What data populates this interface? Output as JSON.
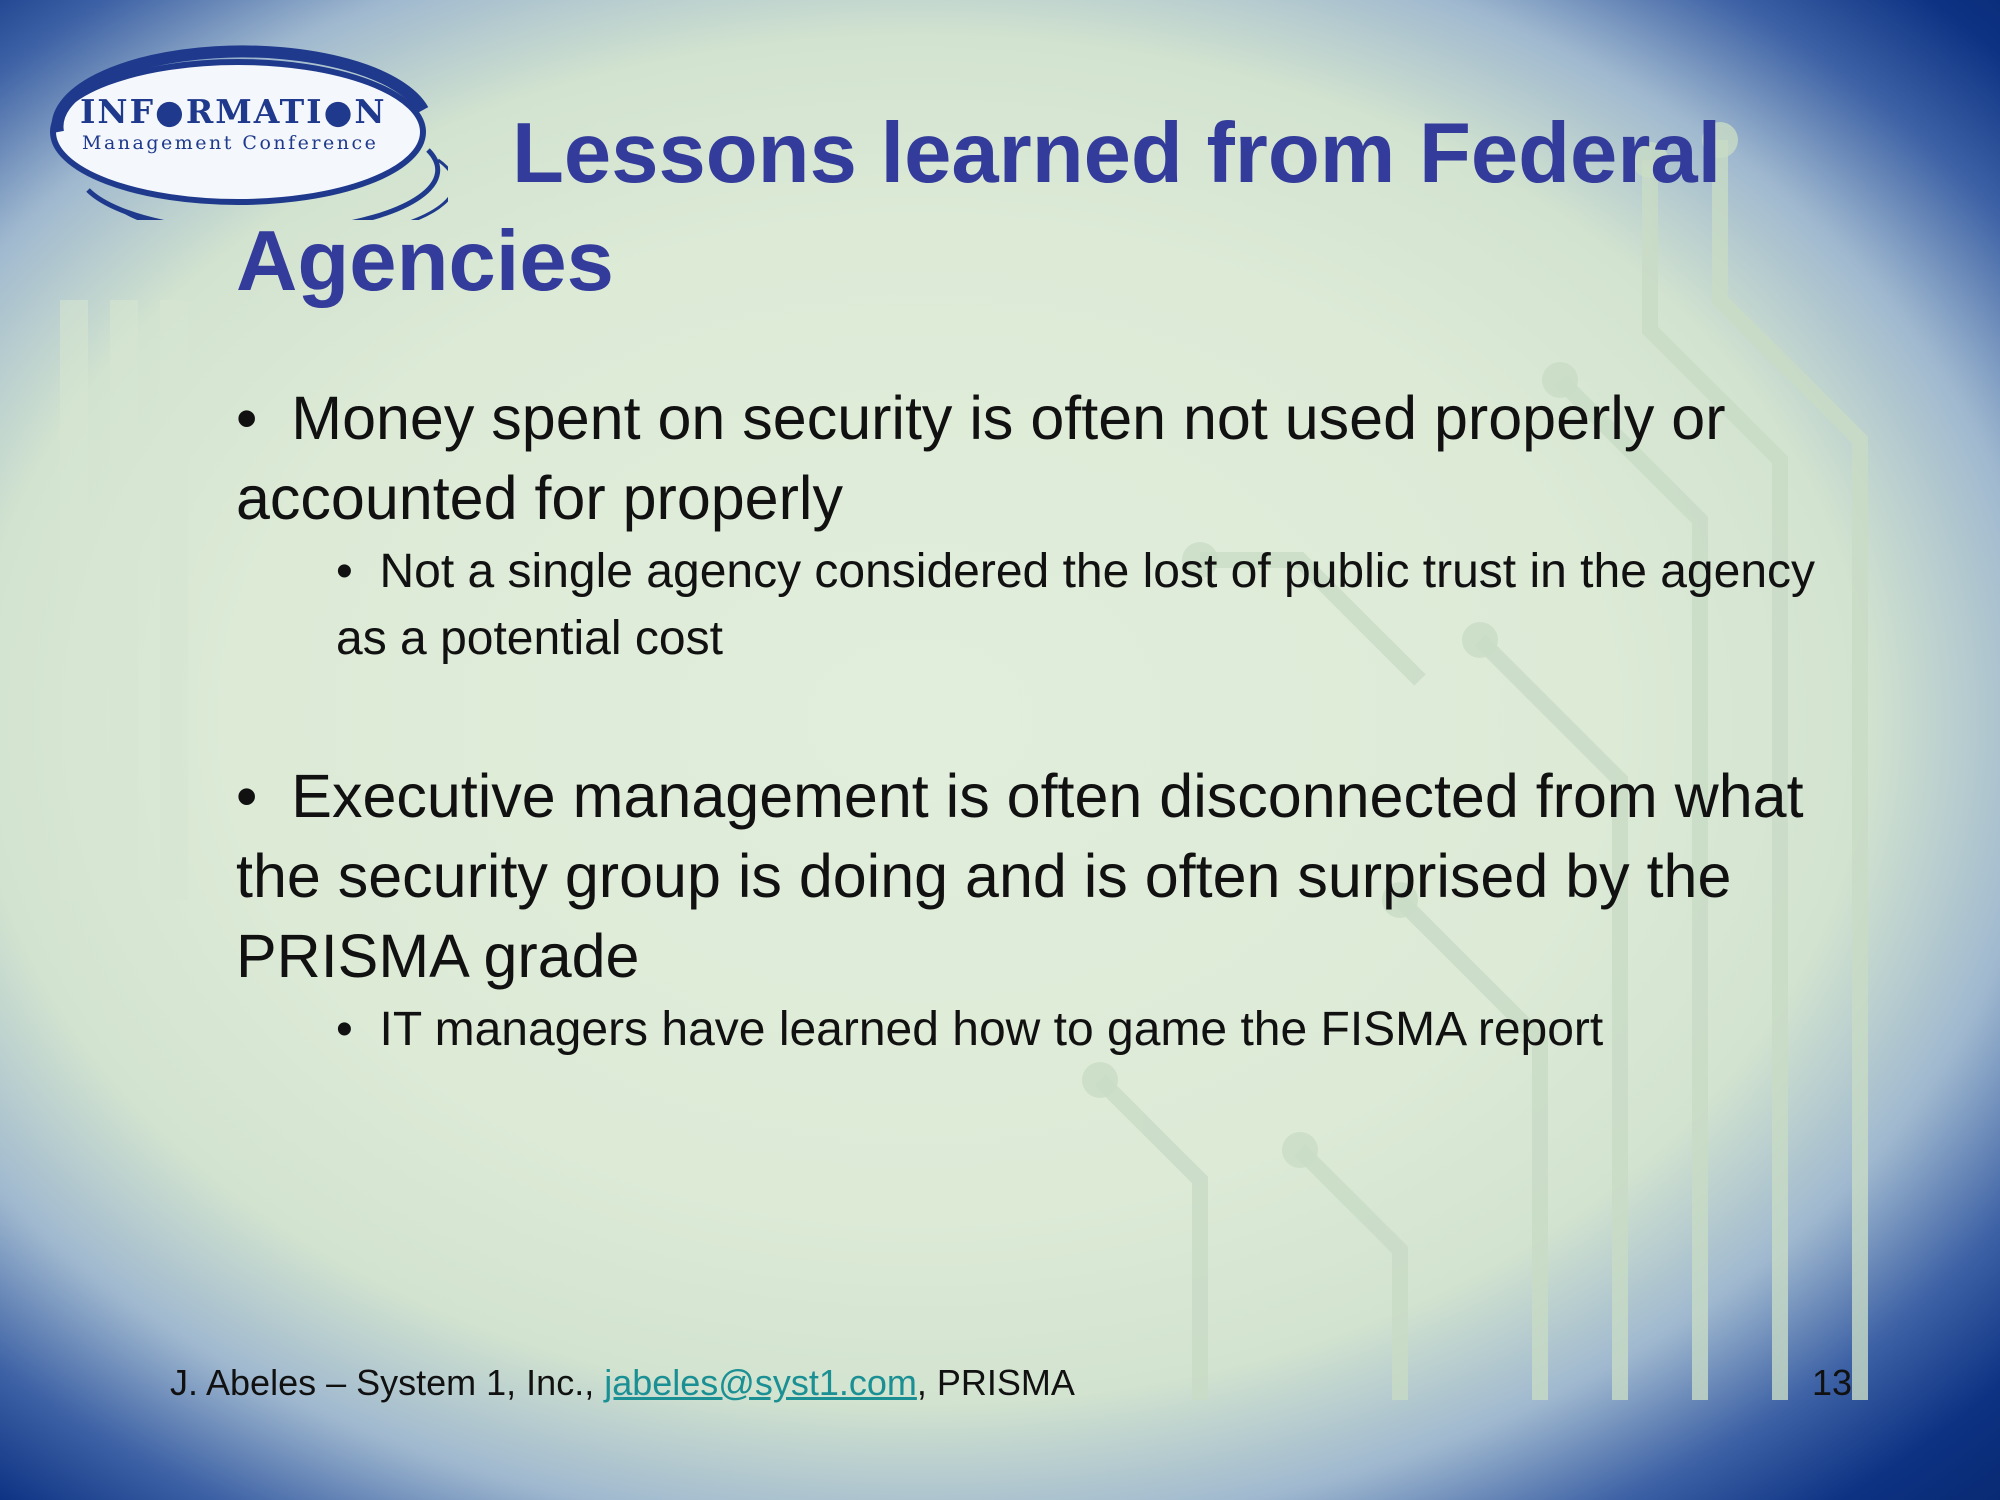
{
  "logo": {
    "line1": "INF●RMATI●N",
    "line2": "Management Conference"
  },
  "slide": {
    "title": "Lessons learned from Federal Agencies",
    "bullets": [
      {
        "text": "Money spent on security is often not used properly or accounted for properly",
        "subbullets": [
          "Not a single agency considered the lost of public trust in the agency as a potential cost"
        ]
      },
      {
        "text": "Executive management is often disconnected from what the security group is doing and is often surprised by the PRISMA grade",
        "subbullets": [
          "IT managers have learned how to game the FISMA report"
        ]
      }
    ]
  },
  "footer": {
    "author": "J. Abeles – System 1, Inc., ",
    "email": "jabeles@syst1.com",
    "suffix": ", PRISMA",
    "page_number": "13"
  },
  "colors": {
    "title": "#333b9b",
    "border": "#0b3080",
    "link": "#1a8f94"
  }
}
